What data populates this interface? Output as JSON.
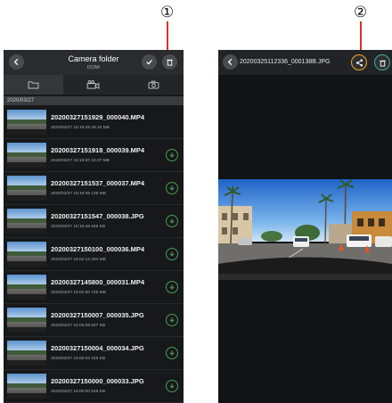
{
  "callouts": [
    "①",
    "②"
  ],
  "folder": {
    "title": "Camera folder",
    "subtitle": "DCIM/",
    "tabs": [
      "folder-icon",
      "video-camera-icon",
      "camera-icon"
    ],
    "date_group": "2020/03/27",
    "files": [
      {
        "name": "20200327151929_000040.MP4",
        "meta": "2020/03/27 15:19:28  26.16 MB"
      },
      {
        "name": "20200327151918_000039.MP4",
        "meta": "2020/03/27 15:19:20  15.07 MB"
      },
      {
        "name": "20200327151537_000037.MP4",
        "meta": "2020/03/27 15:16:08  129 MB"
      },
      {
        "name": "20200327151547_000038.JPG",
        "meta": "2020/03/27 15:15:46  646 KB"
      },
      {
        "name": "20200327150100_000036.MP4",
        "meta": "2020/03/27 15:02:12  294 MB"
      },
      {
        "name": "20200327145800_000031.MP4",
        "meta": "2020/03/27 15:01:00  725 MB"
      },
      {
        "name": "20200327150007_000035.JPG",
        "meta": "2020/03/27 15:00:08  527 KB"
      },
      {
        "name": "20200327150004_000034.JPG",
        "meta": "2020/03/27 15:00:04  315 KB"
      },
      {
        "name": "20200327150000_000033.JPG",
        "meta": "2020/03/27 15:00:00  516 KB"
      }
    ]
  },
  "viewer": {
    "filename": "20200325112336_000138B.JPG",
    "share_color": "#f2a91c",
    "delete_color": "#3fae9a"
  },
  "colors": {
    "callout_line": "#e03027",
    "download": "#4a9b55"
  }
}
